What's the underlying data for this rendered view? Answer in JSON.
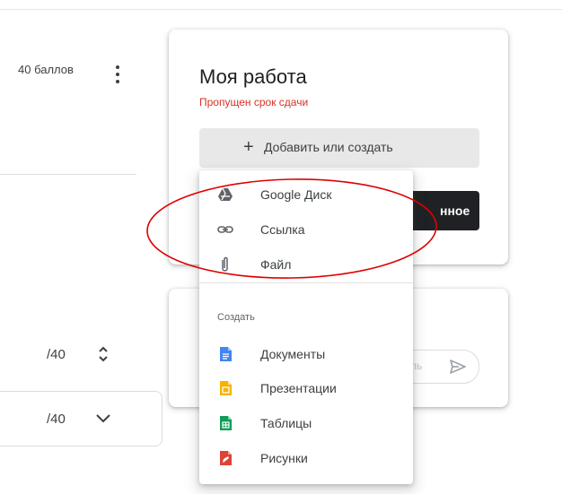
{
  "assignment": {
    "points": "40 баллов",
    "grades": [
      {
        "value": "/40",
        "control": "spinner"
      },
      {
        "value": "/40",
        "control": "dropdown"
      }
    ]
  },
  "my_work": {
    "title": "Моя работа",
    "status": "Пропущен срок сдачи",
    "status_color": "#d93025",
    "add_button": "Добавить или создать",
    "submit_button_partial": "нное"
  },
  "private_comment": {
    "placeholder_partial": "ль"
  },
  "attach_menu": {
    "items": [
      {
        "label": "Google Диск",
        "icon": "google-drive-icon"
      },
      {
        "label": "Ссылка",
        "icon": "link-icon"
      },
      {
        "label": "Файл",
        "icon": "attachment-icon"
      }
    ],
    "create_section": "Создать",
    "create_items": [
      {
        "label": "Документы",
        "icon": "docs-icon",
        "color": "#4285f4"
      },
      {
        "label": "Презентации",
        "icon": "slides-icon",
        "color": "#f4b400"
      },
      {
        "label": "Таблицы",
        "icon": "sheets-icon",
        "color": "#0f9d58"
      },
      {
        "label": "Рисунки",
        "icon": "drawings-icon",
        "color": "#db4437"
      }
    ]
  },
  "annotation": {
    "color": "#e00000"
  }
}
